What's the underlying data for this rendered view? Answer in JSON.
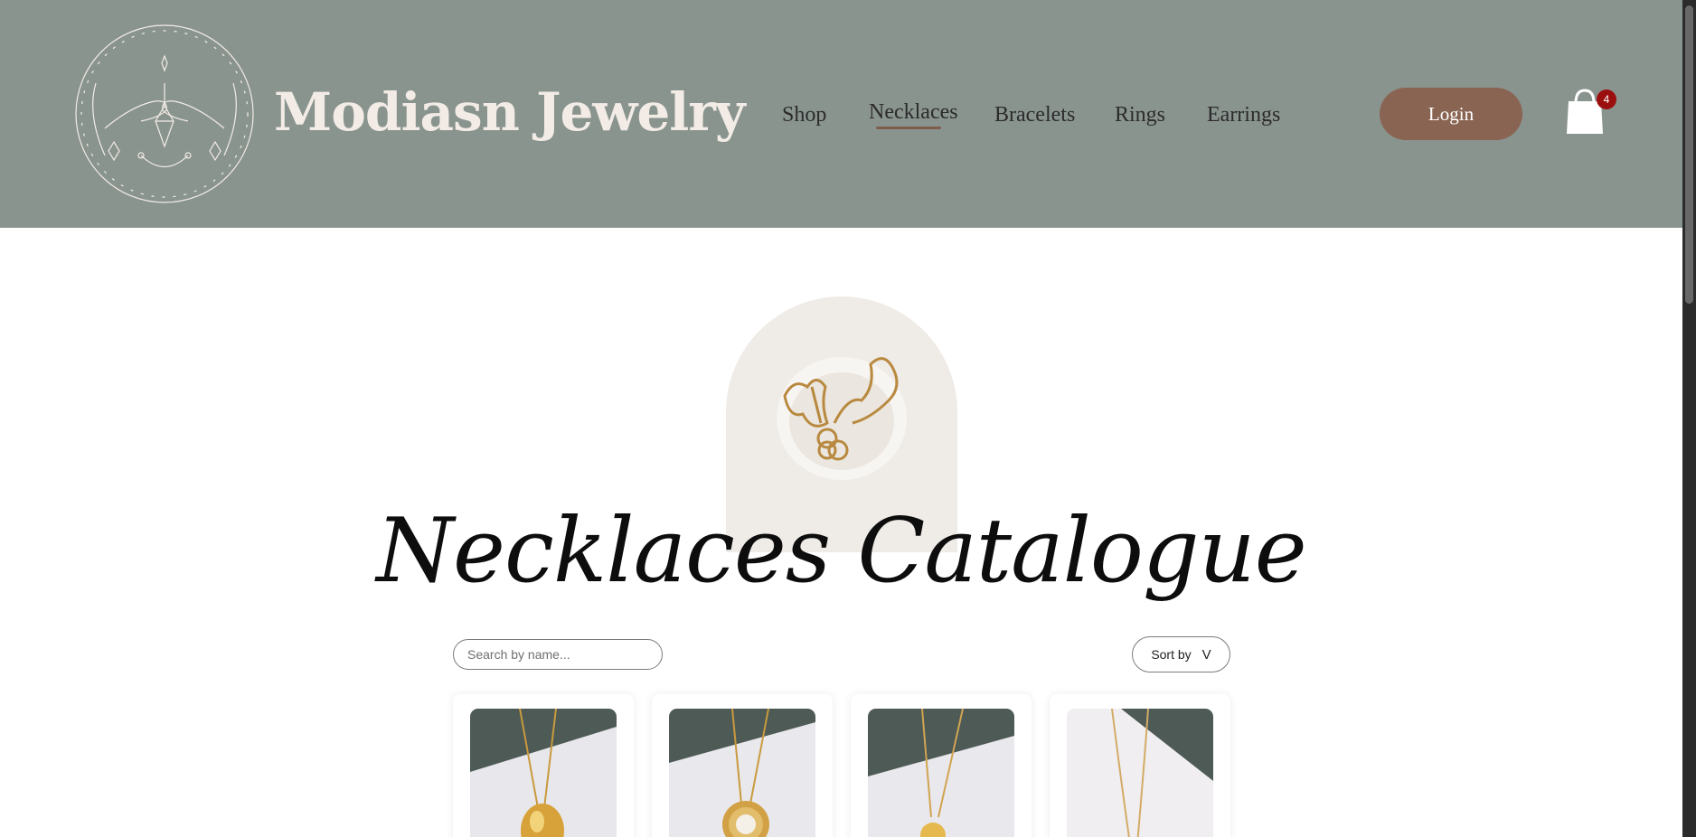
{
  "header": {
    "brand": "Modiasn Jewelry",
    "nav": [
      {
        "label": "Shop"
      },
      {
        "label": "Necklaces"
      },
      {
        "label": "Bracelets"
      },
      {
        "label": "Rings"
      },
      {
        "label": "Earrings"
      }
    ],
    "active_nav": "Necklaces",
    "login_label": "Login",
    "cart_count": "4",
    "colors": {
      "background": "#8a948f",
      "accent": "#8a6452",
      "badge": "#9c0f0f"
    }
  },
  "icons": [
    "logo-wreath-icon",
    "shopping-bag-icon"
  ],
  "main": {
    "title": "Necklaces Catalogue",
    "search_placeholder": "Search by name...",
    "sort_label": "Sort by",
    "sort_icon": "V",
    "product_count_visible": 4
  }
}
